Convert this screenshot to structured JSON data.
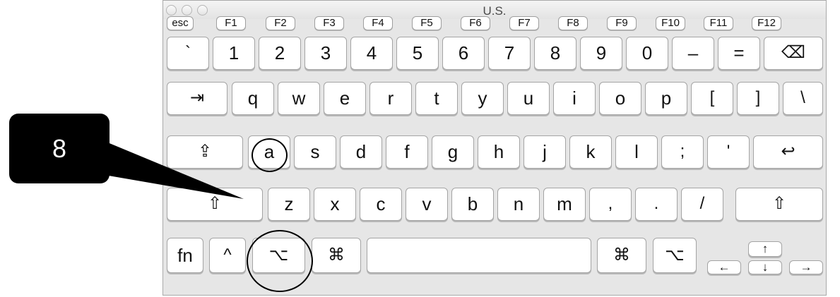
{
  "window": {
    "title": "U.S."
  },
  "function_row": [
    "esc",
    "F1",
    "F2",
    "F3",
    "F4",
    "F5",
    "F6",
    "F7",
    "F8",
    "F9",
    "F10",
    "F11",
    "F12"
  ],
  "number_row": [
    "`",
    "1",
    "2",
    "3",
    "4",
    "5",
    "6",
    "7",
    "8",
    "9",
    "0",
    "–",
    "=",
    "⌫"
  ],
  "top_row": [
    "⇥",
    "q",
    "w",
    "e",
    "r",
    "t",
    "y",
    "u",
    "i",
    "o",
    "p",
    "[",
    "]",
    "\\"
  ],
  "home_row": [
    "⇪",
    "a",
    "s",
    "d",
    "f",
    "g",
    "h",
    "j",
    "k",
    "l",
    ";",
    "'",
    "↩"
  ],
  "bottom_row": [
    "⇧",
    "z",
    "x",
    "c",
    "v",
    "b",
    "n",
    "m",
    ",",
    ".",
    "/",
    "⇧"
  ],
  "modifier_row": [
    "fn",
    "^",
    "⌥",
    "⌘",
    "",
    "⌘",
    "⌥"
  ],
  "arrows": {
    "up": "↑",
    "down": "↓",
    "left": "←",
    "right": "→"
  },
  "callout": {
    "label": "8"
  },
  "highlighted_keys": [
    "a",
    "⌥"
  ]
}
